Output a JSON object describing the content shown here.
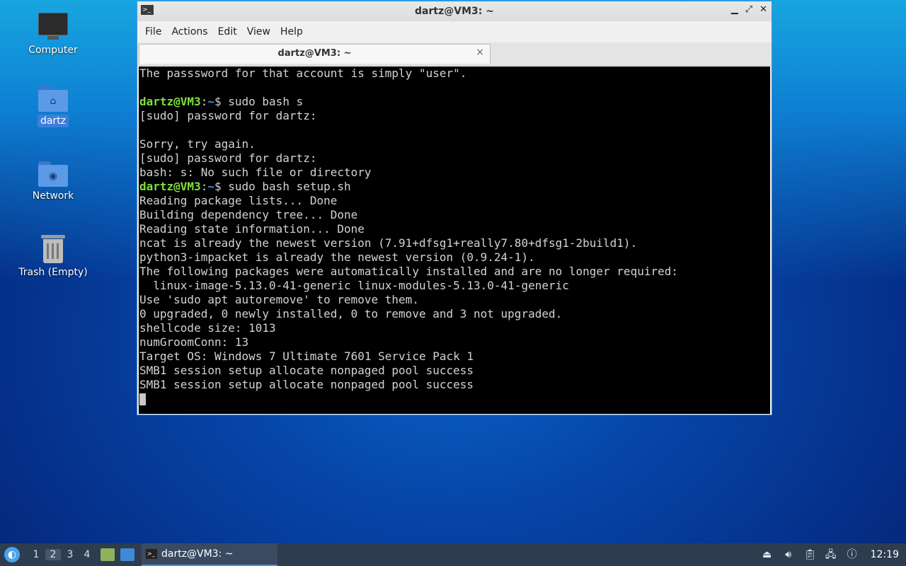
{
  "desktop": {
    "icons": [
      {
        "label": "Computer"
      },
      {
        "label": "dartz"
      },
      {
        "label": "Network"
      },
      {
        "label": "Trash (Empty)"
      }
    ]
  },
  "window": {
    "title": "dartz@VM3: ~",
    "controls": {
      "minimize": "▁",
      "maximize": "⤢",
      "close": "✕"
    },
    "menu": [
      "File",
      "Actions",
      "Edit",
      "View",
      "Help"
    ],
    "tab": {
      "label": "dartz@VM3: ~",
      "close": "×"
    }
  },
  "terminal": {
    "prompt_user": "dartz@VM3",
    "prompt_sep": ":",
    "prompt_path": "~",
    "prompt_suffix": "$ ",
    "lines": [
      {
        "text": "The passsword for that account is simply \"user\"."
      },
      {
        "text": ""
      },
      {
        "prompt": true,
        "text": "sudo bash s"
      },
      {
        "text": "[sudo] password for dartz:"
      },
      {
        "text": ""
      },
      {
        "text": "Sorry, try again."
      },
      {
        "text": "[sudo] password for dartz:"
      },
      {
        "text": "bash: s: No such file or directory"
      },
      {
        "prompt": true,
        "text": "sudo bash setup.sh"
      },
      {
        "text": "Reading package lists... Done"
      },
      {
        "text": "Building dependency tree... Done"
      },
      {
        "text": "Reading state information... Done"
      },
      {
        "text": "ncat is already the newest version (7.91+dfsg1+really7.80+dfsg1-2build1)."
      },
      {
        "text": "python3-impacket is already the newest version (0.9.24-1)."
      },
      {
        "text": "The following packages were automatically installed and are no longer required:"
      },
      {
        "text": "  linux-image-5.13.0-41-generic linux-modules-5.13.0-41-generic"
      },
      {
        "text": "Use 'sudo apt autoremove' to remove them."
      },
      {
        "text": "0 upgraded, 0 newly installed, 0 to remove and 3 not upgraded."
      },
      {
        "text": "shellcode size: 1013"
      },
      {
        "text": "numGroomConn: 13"
      },
      {
        "text": "Target OS: Windows 7 Ultimate 7601 Service Pack 1"
      },
      {
        "text": "SMB1 session setup allocate nonpaged pool success"
      },
      {
        "text": "SMB1 session setup allocate nonpaged pool success"
      }
    ]
  },
  "taskbar": {
    "workspaces": [
      "1",
      "2",
      "3",
      "4"
    ],
    "active_workspace": "2",
    "task_label": "dartz@VM3: ~",
    "clock": "12:19",
    "tray_icons": [
      "eject-icon",
      "volume-icon",
      "clipboard-icon",
      "network-icon",
      "update-notifier-icon"
    ]
  }
}
